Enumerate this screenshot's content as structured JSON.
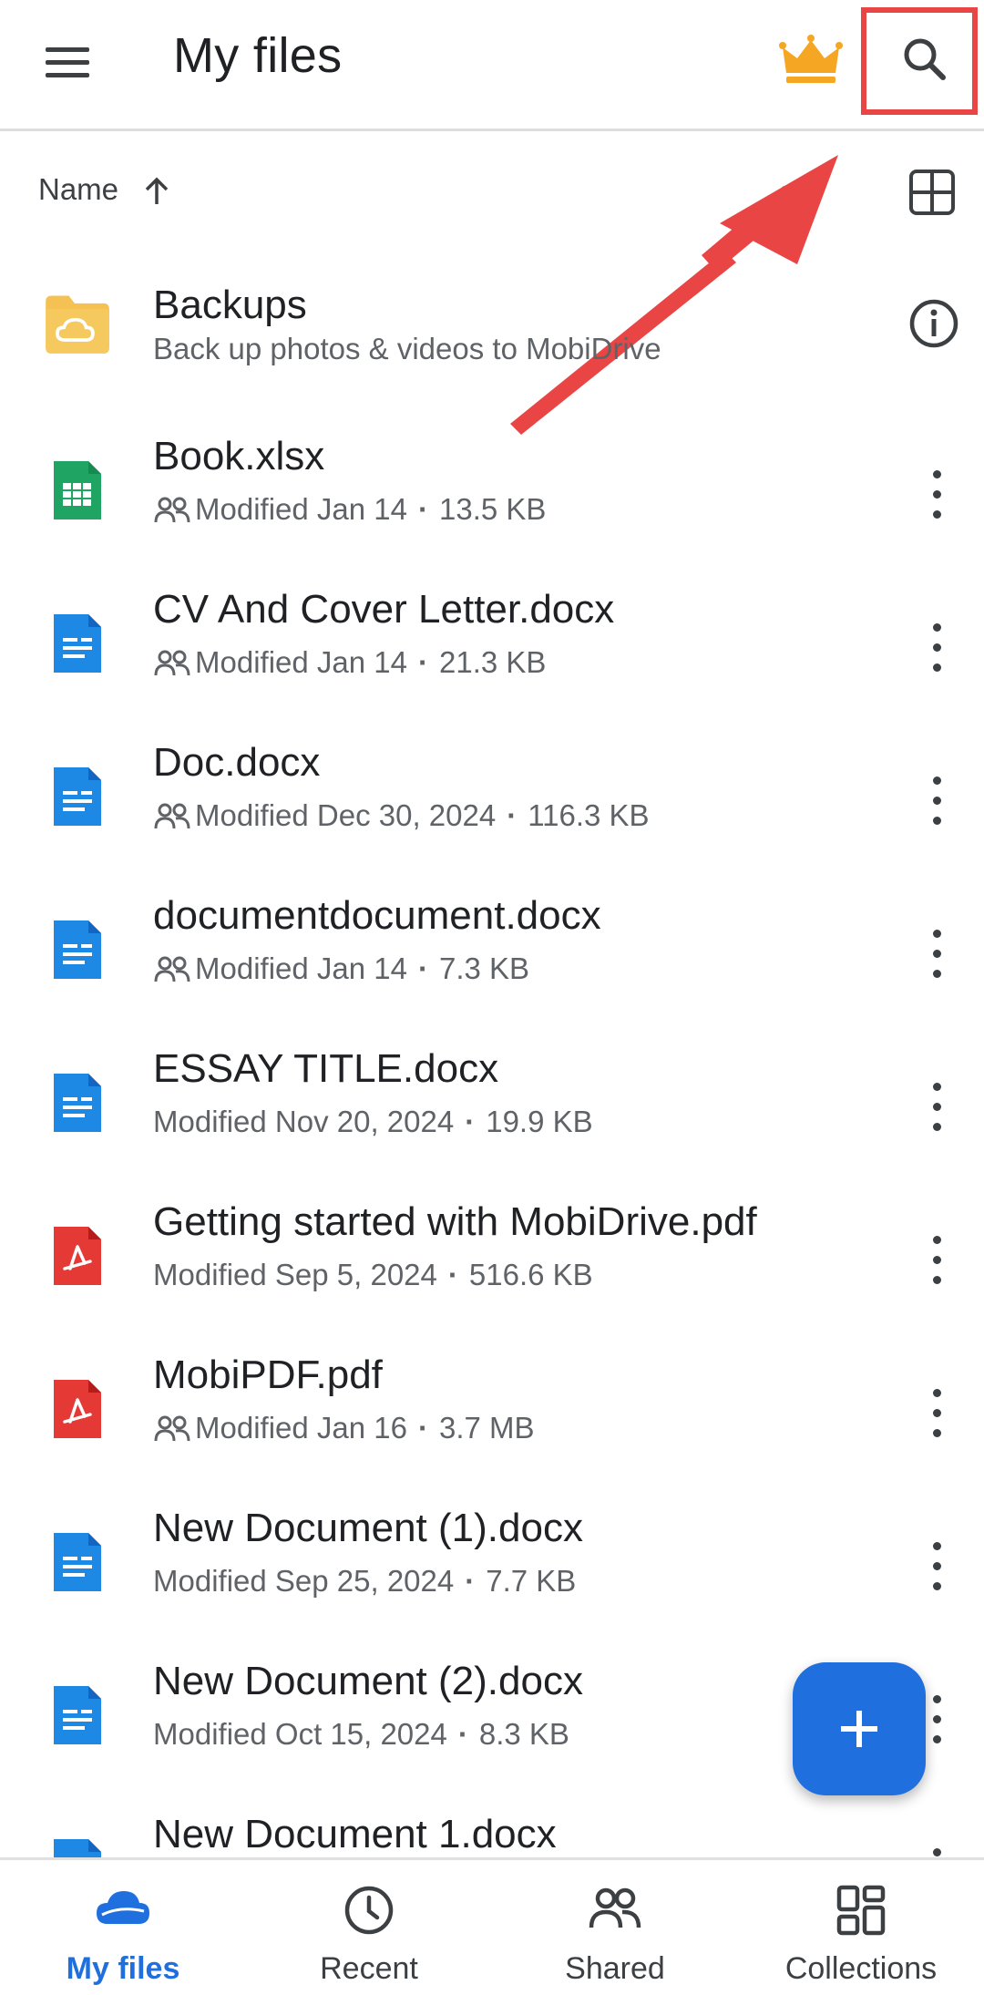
{
  "header": {
    "title": "My files"
  },
  "sort": {
    "label": "Name"
  },
  "files": [
    {
      "name": "Backups",
      "subtitle": "Back up photos & videos to MobiDrive",
      "icon": "folder-cloud-icon"
    },
    {
      "name": "Book.xlsx",
      "modified": "Modified Jan 14",
      "size": "13.5 KB",
      "shared": true,
      "icon": "xlsx-icon"
    },
    {
      "name": "CV And Cover Letter.docx",
      "modified": "Modified Jan 14",
      "size": "21.3 KB",
      "shared": true,
      "icon": "docx-icon"
    },
    {
      "name": "Doc.docx",
      "modified": "Modified Dec 30, 2024",
      "size": "116.3 KB",
      "shared": true,
      "icon": "docx-icon"
    },
    {
      "name": "documentdocument.docx",
      "modified": "Modified Jan 14",
      "size": "7.3 KB",
      "shared": true,
      "icon": "docx-icon"
    },
    {
      "name": "ESSAY TITLE.docx",
      "modified": "Modified Nov 20, 2024",
      "size": "19.9 KB",
      "shared": false,
      "icon": "docx-icon"
    },
    {
      "name": "Getting started with MobiDrive.pdf",
      "modified": "Modified Sep 5, 2024",
      "size": "516.6 KB",
      "shared": false,
      "icon": "pdf-icon"
    },
    {
      "name": "MobiPDF.pdf",
      "modified": "Modified Jan 16",
      "size": "3.7 MB",
      "shared": true,
      "icon": "pdf-icon"
    },
    {
      "name": "New Document (1).docx",
      "modified": "Modified Sep 25, 2024",
      "size": "7.7 KB",
      "shared": false,
      "icon": "docx-icon"
    },
    {
      "name": "New Document (2).docx",
      "modified": "Modified Oct 15, 2024",
      "size": "8.3 KB",
      "shared": false,
      "icon": "docx-icon"
    },
    {
      "name": "New Document 1.docx",
      "icon": "docx-icon"
    }
  ],
  "nav": [
    {
      "label": "My files",
      "icon": "cloud-icon",
      "active": true
    },
    {
      "label": "Recent",
      "icon": "clock-icon"
    },
    {
      "label": "Shared",
      "icon": "people-icon"
    },
    {
      "label": "Collections",
      "icon": "collections-icon"
    }
  ],
  "colors": {
    "accent": "#1f6fde",
    "highlight": "#e94545",
    "crown": "#f5a623",
    "xlsx": "#1fa463",
    "docx": "#1e88e5",
    "pdf": "#e53935"
  }
}
